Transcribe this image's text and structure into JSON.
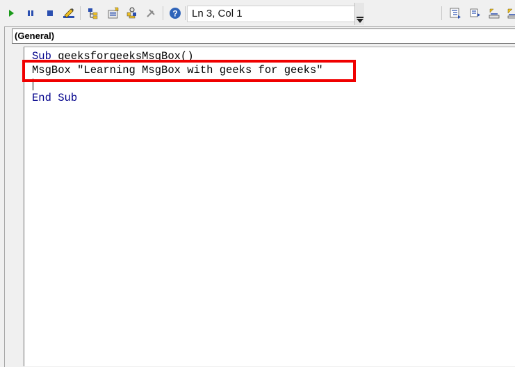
{
  "toolbar": {
    "buttons": [
      {
        "name": "run-icon"
      },
      {
        "name": "break-icon"
      },
      {
        "name": "reset-icon"
      },
      {
        "name": "design-mode-icon"
      },
      {
        "name": "project-explorer-icon"
      },
      {
        "name": "properties-window-icon"
      },
      {
        "name": "object-browser-icon"
      },
      {
        "name": "toolbox-icon"
      },
      {
        "name": "help-icon"
      }
    ],
    "status": "Ln 3, Col 1",
    "right_buttons": [
      {
        "name": "indent-icon"
      },
      {
        "name": "outdent-icon"
      },
      {
        "name": "toggle-breakpoint-icon"
      },
      {
        "name": "comment-block-icon"
      }
    ]
  },
  "editor": {
    "object_combo": "(General)",
    "lines": {
      "line1_kw": "Sub",
      "line1_rest": " geeksforgeeksMsgBox()",
      "line2": "MsgBox \"Learning MsgBox with geeks for geeks\"",
      "line4_kw1": "End",
      "line4_kw2": "Sub"
    }
  },
  "colors": {
    "keyword": "#00008b",
    "highlight_border": "#f00000"
  }
}
